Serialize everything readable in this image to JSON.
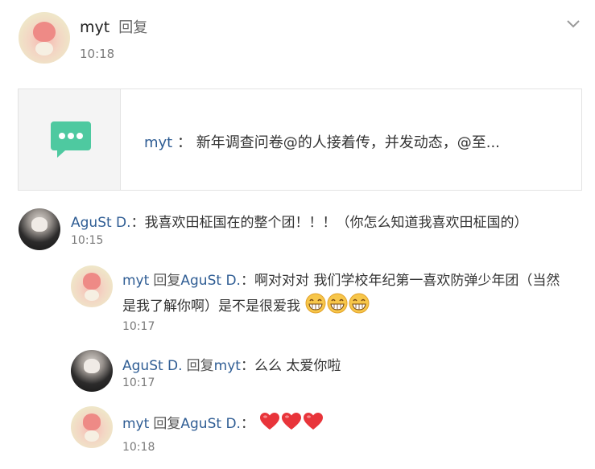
{
  "header": {
    "username": "myt",
    "action": "回复",
    "time": "10:18"
  },
  "card": {
    "icon": "message-bubble-icon",
    "author": "myt",
    "separator": "：",
    "excerpt": "新年调查问卷@的人接着传，并发动态，@至..."
  },
  "comments": [
    {
      "author": "AguSt D.",
      "text": "：我喜欢田柾国在的整个团！！！（你怎么知道我喜欢田柾国的）",
      "time": "10:15"
    }
  ],
  "replies": [
    {
      "author": "myt",
      "reply_word": "回复",
      "target": "AguSt D.",
      "text_line1": "：啊对对对 我们学校年纪第一喜欢防弹少年团（当然",
      "text_line2": "是我了解你啊）是不是很爱我",
      "emoji": "grin-emoji",
      "time": "10:17"
    },
    {
      "author": "AguSt D.",
      "reply_word": "回复",
      "target": "myt",
      "text": "：么么 太爱你啦",
      "time": "10:17"
    },
    {
      "author": "myt",
      "reply_word": "回复",
      "target": "AguSt D.",
      "text": "：",
      "emoji": "heart-emoji",
      "time": "10:18"
    }
  ],
  "colors": {
    "name_link": "#2f5d94",
    "card_icon": "#4ec9a0",
    "heart": "#e8343a"
  }
}
